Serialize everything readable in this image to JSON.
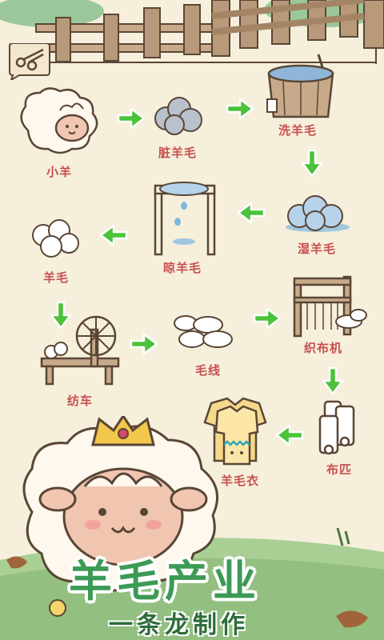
{
  "colors": {
    "accent_green": "#3c9a55",
    "label_red": "#c84f4f",
    "background": "#f6efdc",
    "arrow_green": "#4cc23a"
  },
  "stages": {
    "lamb": "小羊",
    "dirty_wool": "脏羊毛",
    "wash_wool": "洗羊毛",
    "wet_wool": "湿羊毛",
    "dry_wool": "晾羊毛",
    "wool": "羊毛",
    "spinning_wheel": "纺车",
    "yarn": "毛线",
    "loom": "织布机",
    "cloth": "布匹",
    "sweater": "羊毛衣"
  },
  "banner": {
    "title": "羊毛产业",
    "subtitle": "一条龙制作"
  },
  "icons": {
    "scissors": "scissors-icon",
    "arrow": "arrow-icon"
  }
}
